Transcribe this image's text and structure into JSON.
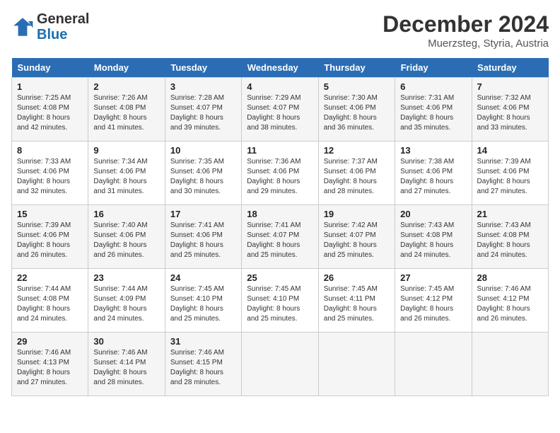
{
  "header": {
    "logo_line1": "General",
    "logo_line2": "Blue",
    "month": "December 2024",
    "location": "Muerzsteg, Styria, Austria"
  },
  "weekdays": [
    "Sunday",
    "Monday",
    "Tuesday",
    "Wednesday",
    "Thursday",
    "Friday",
    "Saturday"
  ],
  "weeks": [
    [
      {
        "day": "1",
        "sunrise": "Sunrise: 7:25 AM",
        "sunset": "Sunset: 4:08 PM",
        "daylight": "Daylight: 8 hours and 42 minutes."
      },
      {
        "day": "2",
        "sunrise": "Sunrise: 7:26 AM",
        "sunset": "Sunset: 4:08 PM",
        "daylight": "Daylight: 8 hours and 41 minutes."
      },
      {
        "day": "3",
        "sunrise": "Sunrise: 7:28 AM",
        "sunset": "Sunset: 4:07 PM",
        "daylight": "Daylight: 8 hours and 39 minutes."
      },
      {
        "day": "4",
        "sunrise": "Sunrise: 7:29 AM",
        "sunset": "Sunset: 4:07 PM",
        "daylight": "Daylight: 8 hours and 38 minutes."
      },
      {
        "day": "5",
        "sunrise": "Sunrise: 7:30 AM",
        "sunset": "Sunset: 4:06 PM",
        "daylight": "Daylight: 8 hours and 36 minutes."
      },
      {
        "day": "6",
        "sunrise": "Sunrise: 7:31 AM",
        "sunset": "Sunset: 4:06 PM",
        "daylight": "Daylight: 8 hours and 35 minutes."
      },
      {
        "day": "7",
        "sunrise": "Sunrise: 7:32 AM",
        "sunset": "Sunset: 4:06 PM",
        "daylight": "Daylight: 8 hours and 33 minutes."
      }
    ],
    [
      {
        "day": "8",
        "sunrise": "Sunrise: 7:33 AM",
        "sunset": "Sunset: 4:06 PM",
        "daylight": "Daylight: 8 hours and 32 minutes."
      },
      {
        "day": "9",
        "sunrise": "Sunrise: 7:34 AM",
        "sunset": "Sunset: 4:06 PM",
        "daylight": "Daylight: 8 hours and 31 minutes."
      },
      {
        "day": "10",
        "sunrise": "Sunrise: 7:35 AM",
        "sunset": "Sunset: 4:06 PM",
        "daylight": "Daylight: 8 hours and 30 minutes."
      },
      {
        "day": "11",
        "sunrise": "Sunrise: 7:36 AM",
        "sunset": "Sunset: 4:06 PM",
        "daylight": "Daylight: 8 hours and 29 minutes."
      },
      {
        "day": "12",
        "sunrise": "Sunrise: 7:37 AM",
        "sunset": "Sunset: 4:06 PM",
        "daylight": "Daylight: 8 hours and 28 minutes."
      },
      {
        "day": "13",
        "sunrise": "Sunrise: 7:38 AM",
        "sunset": "Sunset: 4:06 PM",
        "daylight": "Daylight: 8 hours and 27 minutes."
      },
      {
        "day": "14",
        "sunrise": "Sunrise: 7:39 AM",
        "sunset": "Sunset: 4:06 PM",
        "daylight": "Daylight: 8 hours and 27 minutes."
      }
    ],
    [
      {
        "day": "15",
        "sunrise": "Sunrise: 7:39 AM",
        "sunset": "Sunset: 4:06 PM",
        "daylight": "Daylight: 8 hours and 26 minutes."
      },
      {
        "day": "16",
        "sunrise": "Sunrise: 7:40 AM",
        "sunset": "Sunset: 4:06 PM",
        "daylight": "Daylight: 8 hours and 26 minutes."
      },
      {
        "day": "17",
        "sunrise": "Sunrise: 7:41 AM",
        "sunset": "Sunset: 4:06 PM",
        "daylight": "Daylight: 8 hours and 25 minutes."
      },
      {
        "day": "18",
        "sunrise": "Sunrise: 7:41 AM",
        "sunset": "Sunset: 4:07 PM",
        "daylight": "Daylight: 8 hours and 25 minutes."
      },
      {
        "day": "19",
        "sunrise": "Sunrise: 7:42 AM",
        "sunset": "Sunset: 4:07 PM",
        "daylight": "Daylight: 8 hours and 25 minutes."
      },
      {
        "day": "20",
        "sunrise": "Sunrise: 7:43 AM",
        "sunset": "Sunset: 4:08 PM",
        "daylight": "Daylight: 8 hours and 24 minutes."
      },
      {
        "day": "21",
        "sunrise": "Sunrise: 7:43 AM",
        "sunset": "Sunset: 4:08 PM",
        "daylight": "Daylight: 8 hours and 24 minutes."
      }
    ],
    [
      {
        "day": "22",
        "sunrise": "Sunrise: 7:44 AM",
        "sunset": "Sunset: 4:08 PM",
        "daylight": "Daylight: 8 hours and 24 minutes."
      },
      {
        "day": "23",
        "sunrise": "Sunrise: 7:44 AM",
        "sunset": "Sunset: 4:09 PM",
        "daylight": "Daylight: 8 hours and 24 minutes."
      },
      {
        "day": "24",
        "sunrise": "Sunrise: 7:45 AM",
        "sunset": "Sunset: 4:10 PM",
        "daylight": "Daylight: 8 hours and 25 minutes."
      },
      {
        "day": "25",
        "sunrise": "Sunrise: 7:45 AM",
        "sunset": "Sunset: 4:10 PM",
        "daylight": "Daylight: 8 hours and 25 minutes."
      },
      {
        "day": "26",
        "sunrise": "Sunrise: 7:45 AM",
        "sunset": "Sunset: 4:11 PM",
        "daylight": "Daylight: 8 hours and 25 minutes."
      },
      {
        "day": "27",
        "sunrise": "Sunrise: 7:45 AM",
        "sunset": "Sunset: 4:12 PM",
        "daylight": "Daylight: 8 hours and 26 minutes."
      },
      {
        "day": "28",
        "sunrise": "Sunrise: 7:46 AM",
        "sunset": "Sunset: 4:12 PM",
        "daylight": "Daylight: 8 hours and 26 minutes."
      }
    ],
    [
      {
        "day": "29",
        "sunrise": "Sunrise: 7:46 AM",
        "sunset": "Sunset: 4:13 PM",
        "daylight": "Daylight: 8 hours and 27 minutes."
      },
      {
        "day": "30",
        "sunrise": "Sunrise: 7:46 AM",
        "sunset": "Sunset: 4:14 PM",
        "daylight": "Daylight: 8 hours and 28 minutes."
      },
      {
        "day": "31",
        "sunrise": "Sunrise: 7:46 AM",
        "sunset": "Sunset: 4:15 PM",
        "daylight": "Daylight: 8 hours and 28 minutes."
      },
      null,
      null,
      null,
      null
    ]
  ]
}
